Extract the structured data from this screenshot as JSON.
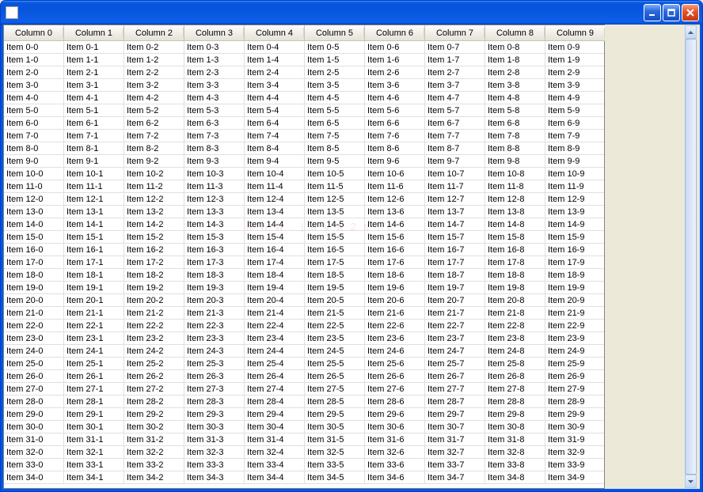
{
  "window": {
    "title": ""
  },
  "table": {
    "column_count": 10,
    "row_count": 35,
    "header_prefix": "Column ",
    "cell_prefix": "Item ",
    "headers": [
      "Column 0",
      "Column 1",
      "Column 2",
      "Column 3",
      "Column 4",
      "Column 5",
      "Column 6",
      "Column 7",
      "Column 8",
      "Column 9"
    ]
  },
  "watermark": "w w w . j a v a 2 s . c"
}
